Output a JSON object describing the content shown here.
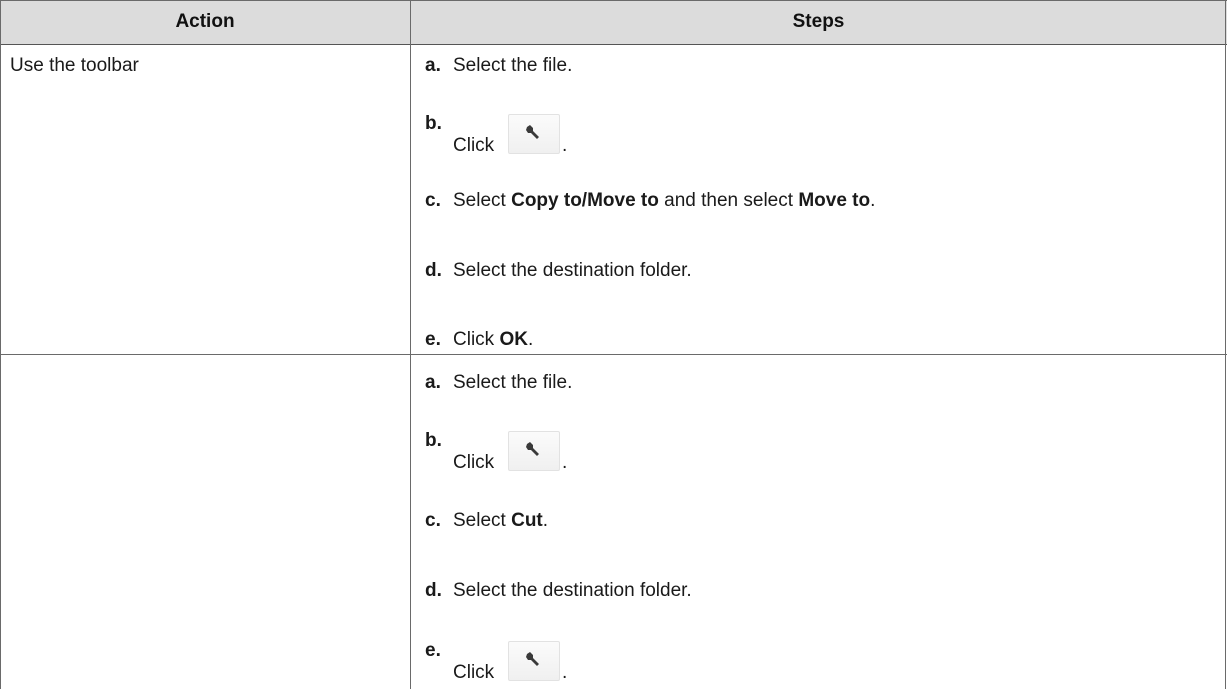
{
  "table": {
    "headers": {
      "action": "Action",
      "steps": "Steps"
    },
    "rows": [
      {
        "action": "Use the toolbar",
        "steps": [
          {
            "marker": "a.",
            "text": "Select the file."
          },
          {
            "marker": "b.",
            "click": "Click",
            "icon": "wrench-icon",
            "end": "."
          },
          {
            "marker": "c.",
            "pre": "Select ",
            "bold1": "Copy to/Move to",
            "mid": " and then select ",
            "bold2": "Move to",
            "end": "."
          },
          {
            "marker": "d.",
            "text": "Select the destination folder."
          },
          {
            "marker": "e.",
            "pre": "Click ",
            "bold1": "OK",
            "end": "."
          }
        ]
      },
      {
        "action": "",
        "steps": [
          {
            "marker": "a.",
            "text": "Select the file."
          },
          {
            "marker": "b.",
            "click": "Click",
            "icon": "wrench-icon",
            "end": "."
          },
          {
            "marker": "c.",
            "pre": "Select ",
            "bold1": "Cut",
            "end": "."
          },
          {
            "marker": "d.",
            "text": "Select the destination folder."
          },
          {
            "marker": "e.",
            "click": "Click",
            "icon": "wrench-icon",
            "end": "."
          }
        ]
      }
    ]
  },
  "colors": {
    "header_bg": "#dcdcdc",
    "border": "#6a6a6a",
    "text": "#1a1a1a"
  }
}
